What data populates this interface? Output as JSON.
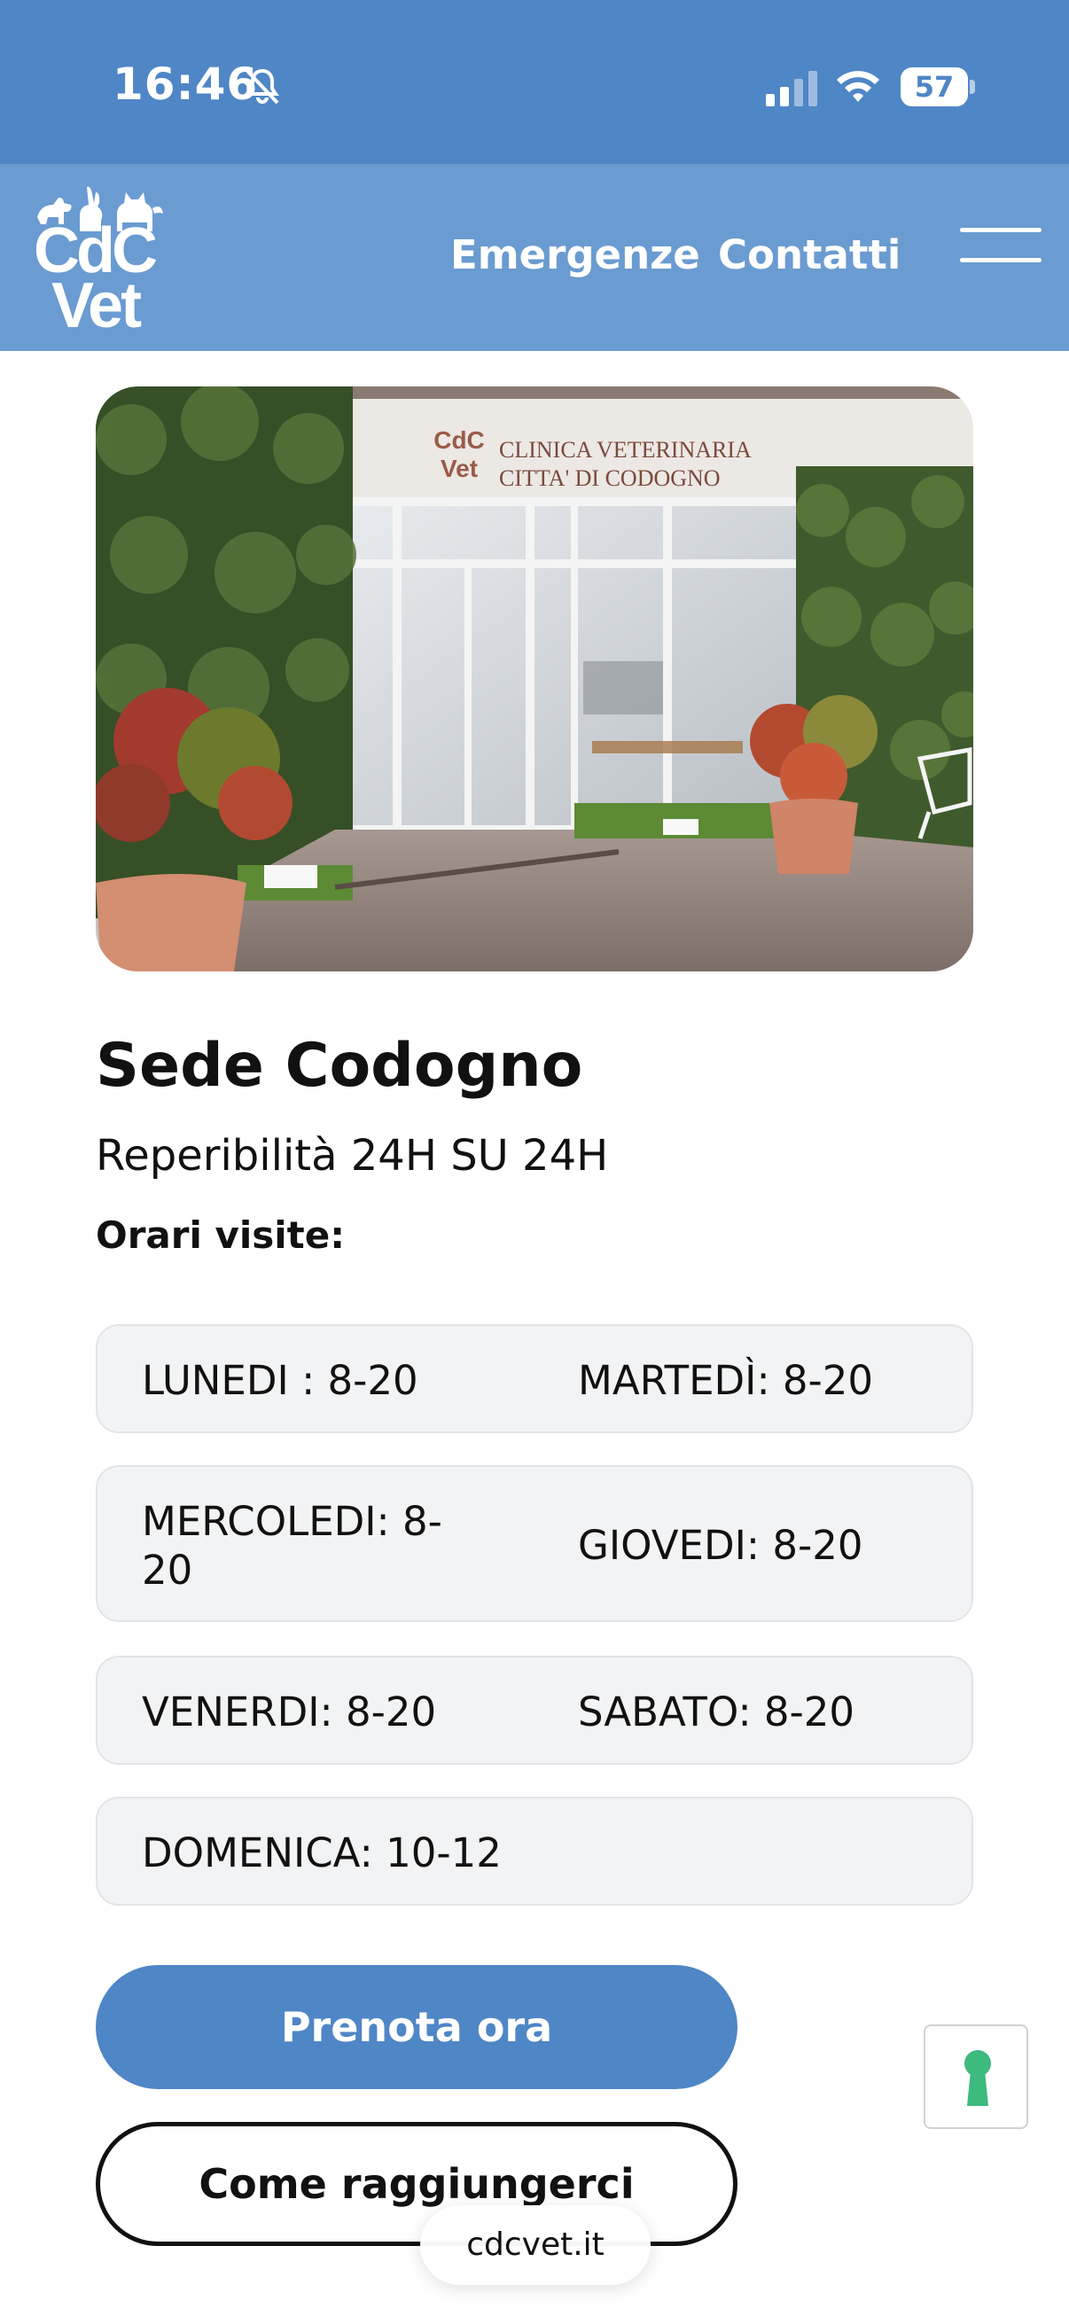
{
  "status_bar": {
    "time": "16:46",
    "battery": "57"
  },
  "header": {
    "logo_line1": "CdC",
    "logo_line2": "Vet",
    "nav": [
      {
        "label": "Emergenze"
      },
      {
        "label": "Contatti"
      }
    ]
  },
  "hero": {
    "sign_line1": "CLINICA VETERINARIA",
    "sign_line2": "CITTA' DI CODOGNO",
    "sign_logo_line1": "CdC",
    "sign_logo_line2": "Vet"
  },
  "location": {
    "title": "Sede Codogno",
    "subtitle": "Reperibilità 24H SU 24H",
    "hours_heading": "Orari visite:"
  },
  "hours": [
    {
      "left": "LUNEDI : 8-20",
      "right": "MARTEDÌ: 8-20"
    },
    {
      "left_line1": "MERCOLEDI: 8-",
      "left_line2": "20",
      "right": "GIOVEDI: 8-20"
    },
    {
      "left": "VENERDI: 8-20",
      "right": "SABATO: 8-20"
    },
    {
      "left": "DOMENICA: 10-12"
    }
  ],
  "actions": {
    "book": "Prenota ora",
    "directions": "Come raggiungerci"
  },
  "browser": {
    "url": "cdcvet.it"
  },
  "colors": {
    "status_bar": "#4f86c6",
    "header": "#6a9bd1",
    "primary": "#4f86c6",
    "accessibility_icon": "#3dba7e"
  }
}
